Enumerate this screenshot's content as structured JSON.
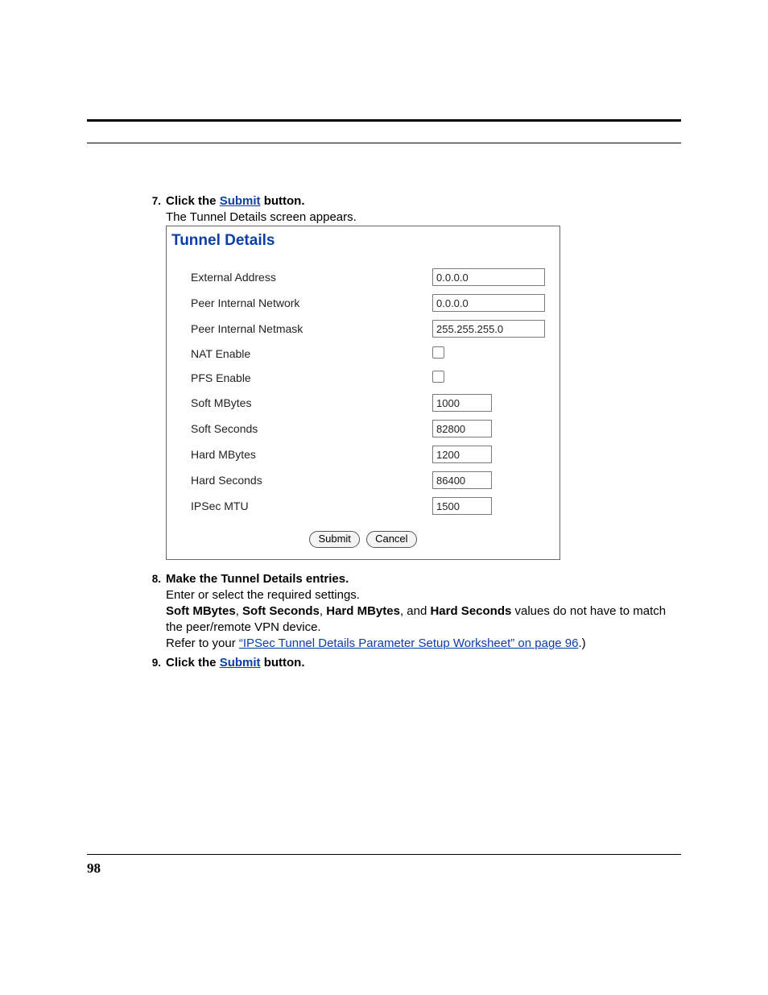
{
  "steps": {
    "s7": {
      "num": "7.",
      "line1_pre": "Click the ",
      "line1_link": "Submit",
      "line1_post": " button.",
      "line2": "The Tunnel Details screen appears."
    },
    "s8": {
      "num": "8.",
      "line1": "Make the Tunnel Details entries.",
      "line2": "Enter or select the required settings.",
      "l3_a": "Soft MBytes",
      "l3_b": ", ",
      "l3_c": "Soft Seconds",
      "l3_d": ", ",
      "l3_e": "Hard MBytes",
      "l3_f": ", and ",
      "l3_g": "Hard Seconds",
      "l3_h": " values do not have to match the peer/remote VPN device.",
      "l4_a": "Refer to your ",
      "l4_link": "“IPSec Tunnel Details Parameter Setup Worksheet” on page 96",
      "l4_b": ".)"
    },
    "s9": {
      "num": "9.",
      "line1_pre": "Click the ",
      "line1_link": "Submit",
      "line1_post": " button."
    }
  },
  "screenshot": {
    "title": "Tunnel Details",
    "fields": {
      "ext_addr_label": "External Address",
      "ext_addr_val": "0.0.0.0",
      "peer_net_label": "Peer Internal Network",
      "peer_net_val": "0.0.0.0",
      "peer_mask_label": "Peer Internal Netmask",
      "peer_mask_val": "255.255.255.0",
      "nat_label": "NAT Enable",
      "pfs_label": "PFS Enable",
      "soft_mb_label": "Soft MBytes",
      "soft_mb_val": "1000",
      "soft_sec_label": "Soft Seconds",
      "soft_sec_val": "82800",
      "hard_mb_label": "Hard MBytes",
      "hard_mb_val": "1200",
      "hard_sec_label": "Hard Seconds",
      "hard_sec_val": "86400",
      "mtu_label": "IPSec MTU",
      "mtu_val": "1500"
    },
    "buttons": {
      "submit": "Submit",
      "cancel": "Cancel"
    }
  },
  "page_number": "98"
}
